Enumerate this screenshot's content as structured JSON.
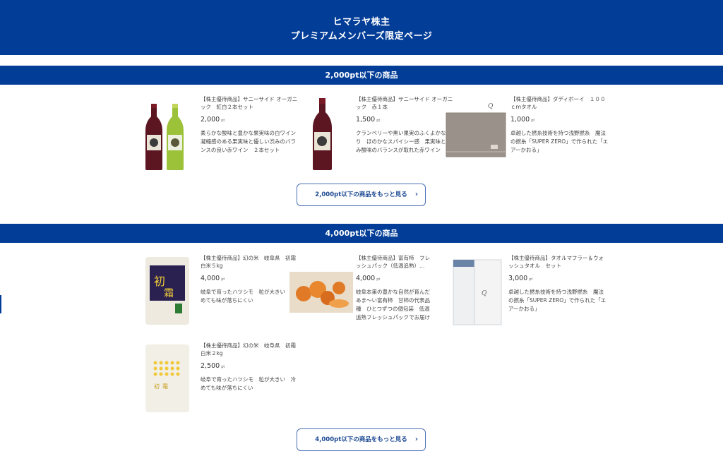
{
  "header": {
    "line1": "ヒマラヤ株主",
    "line2": "プレミアムメンバーズ限定ページ"
  },
  "sections": [
    {
      "title": "2,000pt以下の商品",
      "more_label": "2,000pt以下の商品をもっと見る",
      "items": [
        {
          "name": "【株主優待商品】サニーサイド オーガニック　紅白２本セット",
          "points": "2,000",
          "unit": "pt",
          "desc": "柔らかな酸味と豊かな果実味の白ワイン　凝縮感のある果実味と優しい渋みのバランスの良い赤ワイン　２本セット",
          "image": "wine-pair-image"
        },
        {
          "name": "【株主優待商品】サニーサイド オーガニック　赤１本",
          "points": "1,500",
          "unit": "pt",
          "desc": "クランベリーや黒い果実のふくよかな香り　ほのかなスパイシー感　果実味と渋み酸味のバランスが取れた赤ワイン",
          "image": "red-wine-image"
        },
        {
          "name": "【株主優待商品】ダディボーイ　１００ｃｍタオル",
          "points": "1,000",
          "unit": "pt",
          "desc": "卓越した撚糸技術を持つ浅野撚糸　魔法の撚糸「SUPER ZERO」で作られた「エアーかおる」",
          "image": "towel-image"
        }
      ]
    },
    {
      "title": "4,000pt以下の商品",
      "more_label": "4,000pt以下の商品をもっと見る",
      "items": [
        {
          "name": "【株主優待商品】幻の米　岐阜県　初霜　白米５kg",
          "points": "4,000",
          "unit": "pt",
          "desc": "岐阜で育ったハツシモ　粒が大きい　冷めても味が落ちにくい",
          "image": "rice-5kg-image"
        },
        {
          "name": "【株主優待商品】富有柿　フレッシュパック（低温追熟）…",
          "points": "4,000",
          "unit": "pt",
          "desc": "岐阜本巣の豊かな自然が育んだあま〜い富有柿　甘柿の代表品種　ひとつずつの個包装　低温追熟フレッシュパックでお届け",
          "image": "persimmon-image"
        },
        {
          "name": "【株主優待商品】タオルマフラー＆ウォッシュタオル　セット",
          "points": "3,000",
          "unit": "pt",
          "desc": "卓越した撚糸技術を持つ浅野撚糸　魔法の撚糸「SUPER ZERO」で作られた「エアーかおる」",
          "image": "towel-set-image"
        },
        {
          "name": "【株主優待商品】幻の米　岐阜県　初霜　白米２kg",
          "points": "2,500",
          "unit": "pt",
          "desc": "岐阜で育ったハツシモ　粒が大きい　冷めても味が落ちにくい",
          "image": "rice-2kg-image"
        }
      ]
    }
  ],
  "colors": {
    "brand_blue": "#023d97",
    "button_border": "#4a6fb5",
    "button_text": "#1b4893"
  },
  "icons": {
    "more_chevron": "chevron-right-icon"
  }
}
